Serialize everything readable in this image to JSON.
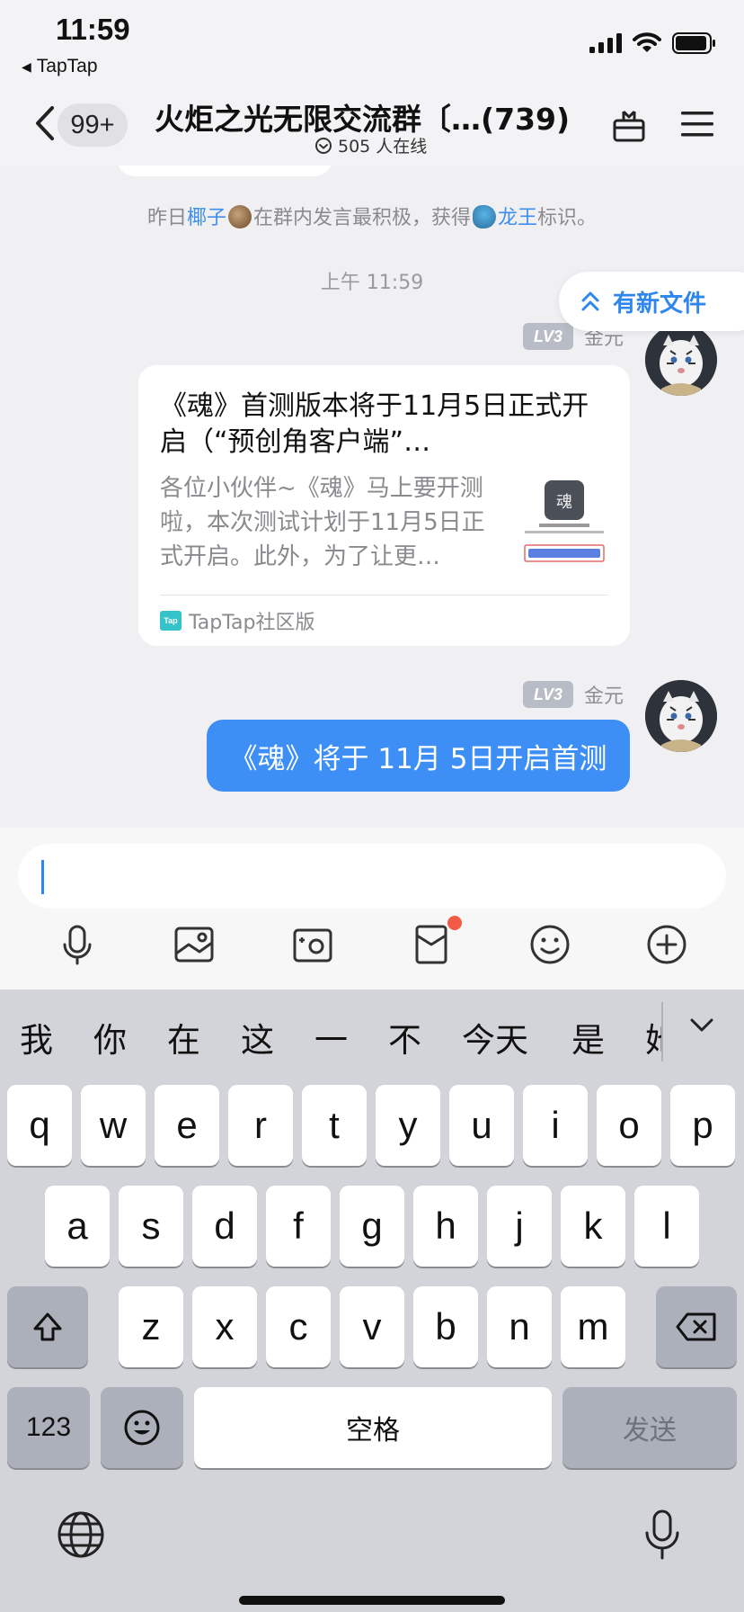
{
  "status_bar": {
    "time": "11:59",
    "back_app": "TapTap"
  },
  "header": {
    "unread_badge": "99+",
    "title": "火炬之光无限交流群〔…(739)",
    "online": "505 人在线"
  },
  "chat": {
    "system_msg": {
      "prefix": "昨日",
      "user": "椰子",
      "middle": "在群内发言最积极，获得",
      "title": "龙王",
      "suffix": "标识。"
    },
    "time_label": "上午 11:59",
    "new_file_pill": "有新文件",
    "sender_name_1": "金元",
    "sender_level": "LV3",
    "card": {
      "title": "《魂》首测版本将于11月5日正式开启（“预创角客户端”…",
      "description": "各位小伙伴~《魂》马上要开测啦，本次测试计划于11月5日正式开启。此外，为了让更…",
      "source": "TapTap社区版",
      "source_logo": "Tap"
    },
    "sender_name_2": "金元",
    "message_text": "《魂》将于 11月 5日开启首测"
  },
  "input": {
    "value": "",
    "tools": [
      "microphone-icon",
      "image-icon",
      "camera-icon",
      "red-packet-icon",
      "emoji-icon",
      "plus-icon"
    ]
  },
  "keyboard": {
    "candidates": [
      "我",
      "你",
      "在",
      "这",
      "一",
      "不",
      "今天",
      "是",
      "她"
    ],
    "row1": [
      "q",
      "w",
      "e",
      "r",
      "t",
      "y",
      "u",
      "i",
      "o",
      "p"
    ],
    "row2": [
      "a",
      "s",
      "d",
      "f",
      "g",
      "h",
      "j",
      "k",
      "l"
    ],
    "row3": [
      "z",
      "x",
      "c",
      "v",
      "b",
      "n",
      "m"
    ],
    "numbers_key": "123",
    "space_key": "空格",
    "send_key": "发送"
  },
  "colors": {
    "accent_blue": "#3d8ff5",
    "link_blue": "#3d8ff0",
    "keyboard_bg": "#d2d4da"
  }
}
